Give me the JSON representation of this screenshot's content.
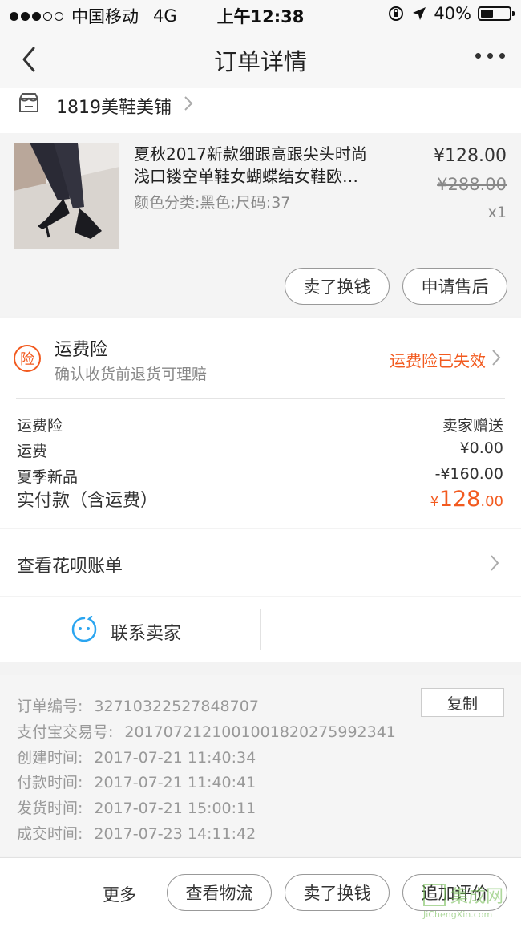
{
  "status_bar": {
    "carrier": "中国移动",
    "network": "4G",
    "time": "上午12:38",
    "battery": "40%",
    "battery_level": 0.4
  },
  "nav": {
    "title": "订单详情",
    "back_icon": "chevron-left-icon",
    "more_icon": "more-horizontal-icon"
  },
  "shop": {
    "name": "1819美鞋美铺",
    "icon": "store-icon"
  },
  "product": {
    "name_line1": "夏秋2017新款细跟高跟尖头时尚",
    "name_line2": "浅口镂空单鞋女蝴蝶结女鞋欧…",
    "sku": "颜色分类:黑色;尺码:37",
    "price": "¥128.00",
    "original_price": "¥288.00",
    "quantity": "x1",
    "buttons": {
      "sell": "卖了换钱",
      "after_sale": "申请售后"
    }
  },
  "insurance": {
    "icon_text": "险",
    "title": "运费险",
    "subtitle": "确认收货前退货可理赔",
    "status": "运费险已失效"
  },
  "fees": [
    {
      "label": "运费险",
      "value": "卖家赠送"
    },
    {
      "label": "运费",
      "value": "¥0.00"
    },
    {
      "label": "夏季新品",
      "value": "-¥160.00"
    }
  ],
  "total": {
    "label": "实付款（含运费）",
    "currency": "¥",
    "int_part": "128",
    "dec_part": ".00"
  },
  "huabei": {
    "label": "查看花呗账单"
  },
  "contact": {
    "label": "联系卖家"
  },
  "order_info": {
    "copy_label": "复制",
    "rows": [
      {
        "label": "订单编号:",
        "value": "32710322527848707"
      },
      {
        "label": "支付宝交易号:",
        "value": "2017072121001001820275992341"
      },
      {
        "label": "创建时间:",
        "value": "2017-07-21 11:40:34"
      },
      {
        "label": "付款时间:",
        "value": "2017-07-21 11:40:41"
      },
      {
        "label": "发货时间:",
        "value": "2017-07-21 15:00:11"
      },
      {
        "label": "成交时间:",
        "value": "2017-07-23 14:11:42"
      }
    ]
  },
  "bottom_bar": {
    "more": "更多",
    "logistics": "查看物流",
    "sell": "卖了换钱",
    "review": "追加评价"
  },
  "watermark": {
    "zh": "集成网",
    "en": "JiChengXin.com"
  },
  "colors": {
    "accent": "#f25a1f",
    "contact_icon": "#2ba5f0"
  }
}
